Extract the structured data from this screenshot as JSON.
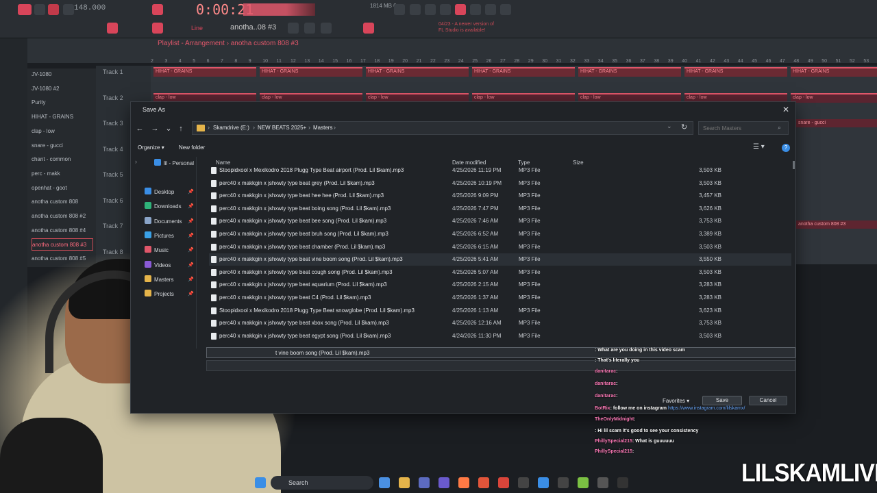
{
  "fl": {
    "bpm": "148.000",
    "song_time": "0:00:21",
    "cpu_ram": "1814 MB\n  0",
    "pattern_name": "anotha..08 #3",
    "line_mode": "Line",
    "update_note": "04/23 - A newer version of FL Studio is available!",
    "playlist_title": "Playlist - Arrangement",
    "playlist_pattern": "anotha custom 808 #3",
    "ruler": [
      "2",
      "3",
      "4",
      "5",
      "6",
      "7",
      "8",
      "9",
      "10",
      "11",
      "12",
      "13",
      "14",
      "15",
      "16",
      "17",
      "18",
      "19",
      "20",
      "21",
      "22",
      "23",
      "24",
      "25",
      "26",
      "27",
      "28",
      "29",
      "30",
      "31",
      "32",
      "33",
      "34",
      "35",
      "36",
      "37",
      "38",
      "39",
      "40",
      "41",
      "42",
      "43",
      "44",
      "45",
      "46",
      "47",
      "48",
      "49",
      "50",
      "51",
      "52",
      "53"
    ]
  },
  "channels": [
    {
      "label": "JV-1080",
      "selected": false
    },
    {
      "label": "JV-1080 #2",
      "selected": false
    },
    {
      "label": "Purity",
      "selected": false
    },
    {
      "label": "HIHAT - GRAINS",
      "selected": false
    },
    {
      "label": "clap - low",
      "selected": false
    },
    {
      "label": "snare - gucci",
      "selected": false
    },
    {
      "label": "chant - common",
      "selected": false
    },
    {
      "label": "perc - makk",
      "selected": false
    },
    {
      "label": "openhat - goot",
      "selected": false
    },
    {
      "label": "anotha custom 808",
      "selected": false
    },
    {
      "label": "anotha custom 808 #2",
      "selected": false
    },
    {
      "label": "anotha custom 808 #4",
      "selected": false
    },
    {
      "label": "anotha custom 808 #3",
      "selected": true
    },
    {
      "label": "anotha custom 808 #5",
      "selected": false
    }
  ],
  "tracks": [
    "Track 1",
    "Track 2",
    "Track 3",
    "Track 4",
    "Track 5",
    "Track 6",
    "Track 7",
    "Track 8"
  ],
  "clips": {
    "hihat": "HIHAT - GRAINS",
    "clap": "clap - low",
    "snare": "snare - gucci",
    "808": "anotha custom 808 #3"
  },
  "dialog": {
    "title": "Save As",
    "breadcrumb": [
      "Skamdrive (E:)",
      "NEW BEATS 2025+",
      "Masters"
    ],
    "search_placeholder": "Search Masters",
    "organize": "Organize",
    "new_folder": "New folder",
    "nav": [
      {
        "label": "lil - Personal",
        "color": "#3a8ee6"
      },
      {
        "label": "Desktop",
        "color": "#3a8ee6"
      },
      {
        "label": "Downloads",
        "color": "#2fb37a"
      },
      {
        "label": "Documents",
        "color": "#8aa4c8"
      },
      {
        "label": "Pictures",
        "color": "#3aa0e6"
      },
      {
        "label": "Music",
        "color": "#e0576a"
      },
      {
        "label": "Videos",
        "color": "#8a5ad6"
      },
      {
        "label": "Masters",
        "color": "#e5b44a"
      },
      {
        "label": "Projects",
        "color": "#e5b44a"
      }
    ],
    "columns": {
      "name": "Name",
      "date": "Date modified",
      "type": "Type",
      "size": "Size"
    },
    "files": [
      {
        "name": "Stoopidxool x Mexikodro 2018 Plugg Type Beat airport (Prod. Lil $kam).mp3",
        "date": "4/25/2026 11:19 PM",
        "type": "MP3 File",
        "size": "3,503 KB"
      },
      {
        "name": "perc40 x makkgin x jshxwty type beat grey (Prod. Lil $kam).mp3",
        "date": "4/25/2026 10:19 PM",
        "type": "MP3 File",
        "size": "3,503 KB"
      },
      {
        "name": "perc40 x makkgin x jshxwty type beat hee hee (Prod. Lil $kam).mp3",
        "date": "4/25/2026 9:09 PM",
        "type": "MP3 File",
        "size": "3,457 KB"
      },
      {
        "name": "perc40 x makkgin x jshxwty type beat boing song (Prod. Lil $kam).mp3",
        "date": "4/25/2026 7:47 PM",
        "type": "MP3 File",
        "size": "3,626 KB"
      },
      {
        "name": "perc40 x makkgin x jshxwty type beat bee song (Prod. Lil $kam).mp3",
        "date": "4/25/2026 7:46 AM",
        "type": "MP3 File",
        "size": "3,753 KB"
      },
      {
        "name": "perc40 x makkgin x jshxwty type beat bruh song (Prod. Lil $kam).mp3",
        "date": "4/25/2026 6:52 AM",
        "type": "MP3 File",
        "size": "3,389 KB"
      },
      {
        "name": "perc40 x makkgin x jshxwty type beat chamber (Prod. Lil $kam).mp3",
        "date": "4/25/2026 6:15 AM",
        "type": "MP3 File",
        "size": "3,503 KB"
      },
      {
        "name": "perc40 x makkgin x jshxwty type beat vine boom song (Prod. Lil $kam).mp3",
        "date": "4/25/2026 5:41 AM",
        "type": "MP3 File",
        "size": "3,550 KB"
      },
      {
        "name": "perc40 x makkgin x jshxwty type beat cough song (Prod. Lil $kam).mp3",
        "date": "4/25/2026 5:07 AM",
        "type": "MP3 File",
        "size": "3,503 KB"
      },
      {
        "name": "perc40 x makkgin x jshxwty type beat aquarium (Prod. Lil $kam).mp3",
        "date": "4/25/2026 2:15 AM",
        "type": "MP3 File",
        "size": "3,283 KB"
      },
      {
        "name": "perc40 x makkgin x jshxwty type beat C4 (Prod. Lil $kam).mp3",
        "date": "4/25/2026 1:37 AM",
        "type": "MP3 File",
        "size": "3,283 KB"
      },
      {
        "name": "Stoopidxool x Mexikodro 2018 Plugg Type Beat snowglobe (Prod. Lil $kam).mp3",
        "date": "4/25/2026 1:13 AM",
        "type": "MP3 File",
        "size": "3,623 KB"
      },
      {
        "name": "perc40 x makkgin x jshxwty type beat xbox song (Prod. Lil $kam).mp3",
        "date": "4/25/2026 12:16 AM",
        "type": "MP3 File",
        "size": "3,753 KB"
      },
      {
        "name": "perc40 x makkgin x jshxwty type beat egypt song (Prod. Lil $kam).mp3",
        "date": "4/24/2026 11:30 PM",
        "type": "MP3 File",
        "size": "3,503 KB"
      }
    ],
    "filename_value": "t vine boom song (Prod. Lil $kam).mp3",
    "favorites": "Favorites",
    "save": "Save",
    "cancel": "Cancel"
  },
  "chat": [
    {
      "user": "",
      "msg": ": What are you doing in this video scam"
    },
    {
      "user": "",
      "msg": ": That's literally you"
    },
    {
      "user": "danitarac",
      "msg": ":"
    },
    {
      "user": "danitarac",
      "msg": ":"
    },
    {
      "user": "danitarac",
      "msg": ":"
    },
    {
      "user": "BotRix",
      "msg": ": follow me on instagram",
      "link": "https://www.instagram.com/lilskamx/"
    },
    {
      "user": "TheOnlyMidnight",
      "msg": ":"
    },
    {
      "user": "",
      "msg": ": Hi lil scam it's good to see your consistency"
    },
    {
      "user": "PhillySpecial215",
      "msg": ": What is guuuuuu"
    },
    {
      "user": "PhillySpecial215",
      "msg": ":"
    }
  ],
  "taskbar": {
    "search_label": "Search"
  },
  "watermark": "LILSKAMLIVE",
  "colors": {
    "accent": "#e0576a",
    "dialog_bg": "#202327",
    "fl_bg": "#2a2e33"
  }
}
